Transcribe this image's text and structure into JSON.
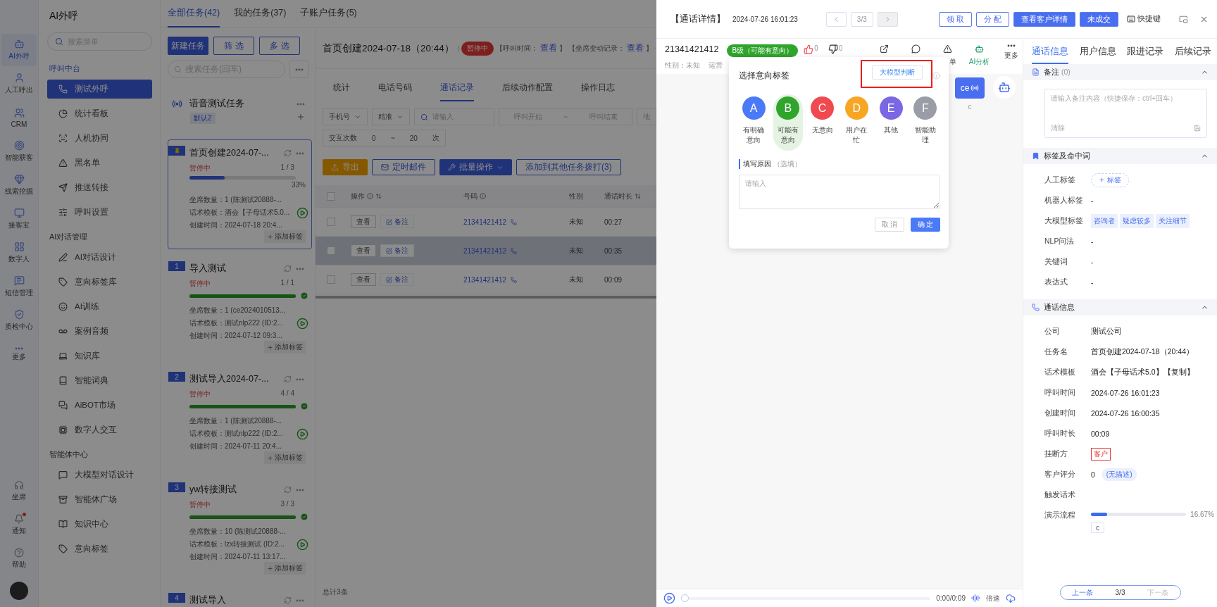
{
  "rail": {
    "items": [
      {
        "label": "AI外呼",
        "selected": true
      },
      {
        "label": "人工呼出",
        "selected": false
      },
      {
        "label": "CRM",
        "selected": false
      },
      {
        "label": "智能获客",
        "selected": false
      },
      {
        "label": "线索挖掘",
        "selected": false
      },
      {
        "label": "接客宝",
        "selected": false
      },
      {
        "label": "数字人",
        "selected": false
      },
      {
        "label": "短信管理",
        "selected": false
      },
      {
        "label": "质检中心",
        "selected": false
      },
      {
        "label": "更多",
        "selected": false
      }
    ],
    "bottom": [
      {
        "label": "坐席",
        "badge": false
      },
      {
        "label": "通知",
        "badge": true
      },
      {
        "label": "帮助",
        "badge": false
      }
    ]
  },
  "menu": {
    "title": "AI外呼",
    "search_placeholder": "搜索菜单",
    "groups": [
      {
        "title": "呼叫中台",
        "items": [
          {
            "label": "测试外呼",
            "selected": true
          },
          {
            "label": "统计看板",
            "selected": false
          },
          {
            "label": "人机协同",
            "selected": false
          },
          {
            "label": "黑名单",
            "selected": false
          },
          {
            "label": "推送转接",
            "selected": false
          },
          {
            "label": "呼叫设置",
            "selected": false
          }
        ]
      },
      {
        "title": "AI对话管理",
        "items": [
          {
            "label": "AI对话设计",
            "selected": false
          },
          {
            "label": "意向标签库",
            "selected": false
          },
          {
            "label": "AI训练",
            "selected": false
          },
          {
            "label": "案例音频",
            "selected": false
          },
          {
            "label": "知识库",
            "selected": false
          },
          {
            "label": "智能词典",
            "selected": false
          },
          {
            "label": "AiBOT市场",
            "selected": false
          },
          {
            "label": "数字人交互",
            "selected": false
          }
        ]
      },
      {
        "title": "智能体中心",
        "items": [
          {
            "label": "大模型对话设计",
            "selected": false
          },
          {
            "label": "智能体广场",
            "selected": false
          },
          {
            "label": "知识中心",
            "selected": false
          },
          {
            "label": "意向标签",
            "selected": false
          }
        ]
      }
    ]
  },
  "task_tabs": [
    {
      "label": "全部任务(42)",
      "selected": true
    },
    {
      "label": "我的任务(37)",
      "selected": false
    },
    {
      "label": "子账户任务(5)",
      "selected": false
    }
  ],
  "task_panel": {
    "buttons": [
      {
        "label": "新建任务",
        "primary": true
      },
      {
        "label": "筛 选",
        "primary": false
      },
      {
        "label": "多 选",
        "primary": false
      }
    ],
    "search_placeholder": "搜索任务(回车)",
    "group": {
      "name": "语音测试任务",
      "tag": "默认2"
    },
    "tasks": [
      {
        "pinned": true,
        "title": "首页创建2024-07-...",
        "selected": true,
        "status": "暂停中",
        "count": "1 / 3",
        "level": 0.33,
        "percent": "33%",
        "done": false,
        "details": [
          "坐席数量：1 (陈测试20888-...",
          "话术模板：酒会【子母话术5.0...",
          "创建时间：2024-07-18 20:4..."
        ],
        "add_tag": "添加标签"
      },
      {
        "pinned": false,
        "number": "1",
        "title": "导入测试",
        "selected": false,
        "status": "暂停中",
        "count": "1 / 1",
        "level": 1,
        "done": true,
        "details": [
          "坐席数量：1 (ce2024010513...",
          "话术模板：测试nlp222 (ID:2...",
          "创建时间：2024-07-12 09:3..."
        ],
        "add_tag": "添加标签"
      },
      {
        "pinned": false,
        "number": "2",
        "title": "测试导入2024-07-...",
        "selected": false,
        "status": "暂停中",
        "count": "4 / 4",
        "level": 1,
        "done": true,
        "details": [
          "坐席数量：1 (陈测试20888-...",
          "话术模板：测试nlp222 (ID:2...",
          "创建时间：2024-07-11 20:4..."
        ],
        "add_tag": "添加标签"
      },
      {
        "pinned": false,
        "number": "3",
        "title": "yw转接测试",
        "selected": false,
        "status": "暂停中",
        "count": "3 / 3",
        "level": 1,
        "done": true,
        "details": [
          "坐席数量：10 (陈测试20888-...",
          "话术模板：lzx转接测试 (ID:2...",
          "创建时间：2024-07-11 13:17..."
        ],
        "add_tag": "添加标签"
      },
      {
        "pinned": false,
        "number": "4",
        "title": "测试导入",
        "selected": false
      }
    ]
  },
  "main": {
    "title": "首页创建2024-07-18（20:44）",
    "status": "暂停中",
    "meta": [
      {
        "text": "【呼叫时间：",
        "link": "查看",
        "end": "】"
      },
      {
        "text": "【坐席变动记录：",
        "link": "查看",
        "end": "】"
      }
    ],
    "tabs": [
      {
        "label": "统计",
        "selected": false
      },
      {
        "label": "电话号码",
        "selected": false
      },
      {
        "label": "通话记录",
        "selected": true
      },
      {
        "label": "后续动作配置",
        "selected": false
      },
      {
        "label": "操作日志",
        "selected": false
      }
    ],
    "filters": {
      "type": "手机号",
      "match": "精准",
      "search_placeholder": "请输入",
      "start_placeholder": "呼叫开始",
      "range_sep": "~",
      "end_placeholder": "呼叫结束",
      "region": "地",
      "count_label": "交互次数",
      "count_min": "0",
      "count_max": "20",
      "count_unit": "次"
    },
    "actions": {
      "export": "导出",
      "mail": "定时邮件",
      "batch": "批量操作",
      "add": "添加到其他任务拨打(3)"
    },
    "table": {
      "all_checked": false,
      "columns": [
        "操作",
        "号码",
        "性别",
        "通话时长"
      ],
      "rows": [
        {
          "view": "查看",
          "note": "备注",
          "phone": "21341421412",
          "gender": "未知",
          "duration": "00:27",
          "selected": false,
          "checked": false
        },
        {
          "view": "查看",
          "note": "备注",
          "phone": "21341421412",
          "gender": "未知",
          "duration": "00:35",
          "selected": true,
          "checked": false
        },
        {
          "view": "查看",
          "note": "备注",
          "phone": "21341421412",
          "gender": "未知",
          "duration": "00:09",
          "selected": false,
          "checked": false
        }
      ]
    },
    "total": "总计3条"
  },
  "detail": {
    "title": "【通话详情】",
    "time": "2024-07-26 16:01:23",
    "pager": "3/3",
    "buttons": [
      {
        "label": "领 取",
        "primary": false
      },
      {
        "label": "分 配",
        "primary": false
      },
      {
        "label": "查看客户详情",
        "primary": true
      },
      {
        "label": "未成交",
        "primary": true
      }
    ],
    "shortcut": "快捷键",
    "phone": "21341421412",
    "grade": "B级（可能有意向）",
    "likes": "0",
    "dislikes": "0",
    "gender": "性别：未知",
    "carrier": "运营",
    "tools": [
      {
        "kind": "share"
      },
      {
        "kind": "chat"
      },
      {
        "kind": "warning",
        "label": "单"
      },
      {
        "kind": "ai",
        "label": "AI分析",
        "selected": true
      },
      {
        "kind": "more",
        "label": "更多",
        "selected": false
      }
    ],
    "bubble": "ce",
    "bubble_caption": "c",
    "player": {
      "time": "0:00/0:09",
      "speed": "倍速",
      "level": 0
    }
  },
  "popover": {
    "title": "选择意向标签",
    "llm_button": "大模型判断",
    "llm_highlighted": true,
    "options": [
      {
        "letter": "A",
        "label": "有明确意向",
        "color": "#4a7af7",
        "selected": false
      },
      {
        "letter": "B",
        "label": "可能有意向",
        "color": "#2fa52c",
        "selected": true
      },
      {
        "letter": "C",
        "label": "无意向",
        "color": "#f0494f",
        "selected": false
      },
      {
        "letter": "D",
        "label": "用户在忙",
        "color": "#f6a623",
        "selected": false
      },
      {
        "letter": "E",
        "label": "其他",
        "color": "#7a67e3",
        "selected": false
      },
      {
        "letter": "F",
        "label": "智能助理",
        "color": "#9a9ca6",
        "selected": false
      }
    ],
    "reason_label": "填写原因",
    "reason_hint": "（选填）",
    "reason_placeholder": "请输入",
    "cancel": "取 消",
    "ok": "确 定"
  },
  "info": {
    "tabs": [
      {
        "label": "通话信息",
        "selected": true
      },
      {
        "label": "用户信息",
        "selected": false
      },
      {
        "label": "跟进记录",
        "selected": false
      },
      {
        "label": "后续记录",
        "selected": false
      }
    ],
    "note": {
      "title": "备注",
      "count": "(0)",
      "placeholder": "请输入备注内容（快捷保存：ctrl+回车）",
      "clear": "清除"
    },
    "tags": {
      "title": "标签及命中词",
      "rows": [
        {
          "kind": "add",
          "label": "人工标签",
          "button": "标签"
        },
        {
          "kind": "text",
          "label": "机器人标签",
          "value": "-"
        },
        {
          "kind": "chips",
          "label": "大模型标签",
          "chips": [
            "咨询者",
            "疑虑较多",
            "关注细节"
          ]
        },
        {
          "kind": "text",
          "label": "NLP问法",
          "value": "-"
        },
        {
          "kind": "text",
          "label": "关键词",
          "value": "-"
        },
        {
          "kind": "text",
          "label": "表达式",
          "value": "-"
        }
      ]
    },
    "call": {
      "title": "通话信息",
      "rows": [
        {
          "kind": "text",
          "label": "公司",
          "value": "测试公司"
        },
        {
          "kind": "text",
          "label": "任务名",
          "value": "首页创建2024-07-18（20:44）"
        },
        {
          "kind": "text",
          "label": "话术模板",
          "value": "酒会【子母话术5.0】【复制】"
        },
        {
          "kind": "text",
          "label": "呼叫时间",
          "value": "2024-07-26 16:01:23"
        },
        {
          "kind": "text",
          "label": "创建时间",
          "value": "2024-07-26 16:00:35"
        },
        {
          "kind": "text",
          "label": "呼叫时长",
          "value": "00:09"
        },
        {
          "kind": "danger",
          "label": "挂断方",
          "value": "客户"
        },
        {
          "kind": "score",
          "label": "客户评分",
          "value": "0",
          "chip": "(无描述)"
        },
        {
          "kind": "empty",
          "label": "触发话术"
        },
        {
          "kind": "progress",
          "label": "演示流程",
          "level": 0.1667,
          "reading": "16.67%",
          "node": "c"
        }
      ]
    },
    "nav": {
      "prev": "上一条",
      "page": "3/3",
      "next": "下一条",
      "next_disabled": true
    }
  }
}
